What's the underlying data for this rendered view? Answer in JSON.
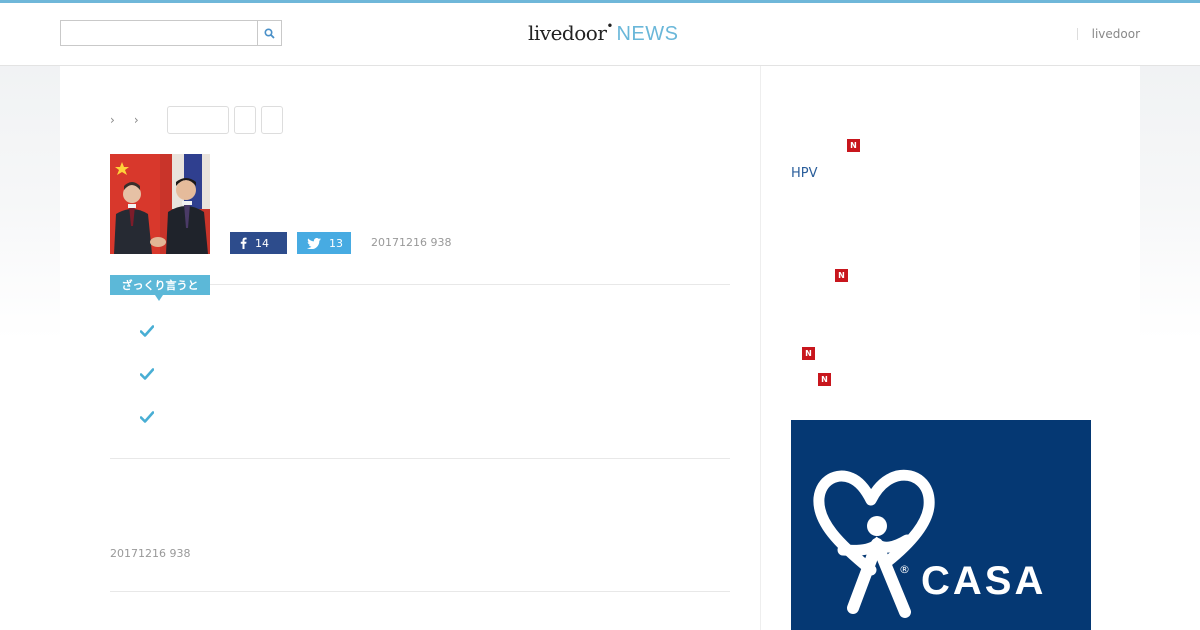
{
  "header": {
    "search_placeholder": "",
    "logo_main": "livedoor",
    "logo_news": "NEWS",
    "right_link": "livedoor",
    "accent_color": "#6fb7d9"
  },
  "breadcrumb": {
    "separators": [
      "›",
      "›"
    ]
  },
  "article": {
    "share_facebook_count": "14",
    "share_twitter_count": "13",
    "date_top": "20171216 938",
    "summary_label": "ざっくり言うと",
    "date_bottom": "20171216 938",
    "facebook_color": "#2d4c8c",
    "twitter_color": "#47abe2"
  },
  "sidebar": {
    "hpv_text": "HPV",
    "new_badge": "N",
    "ad_brand": "CASA",
    "ad_mark": "®",
    "ad_color": "#053873"
  }
}
